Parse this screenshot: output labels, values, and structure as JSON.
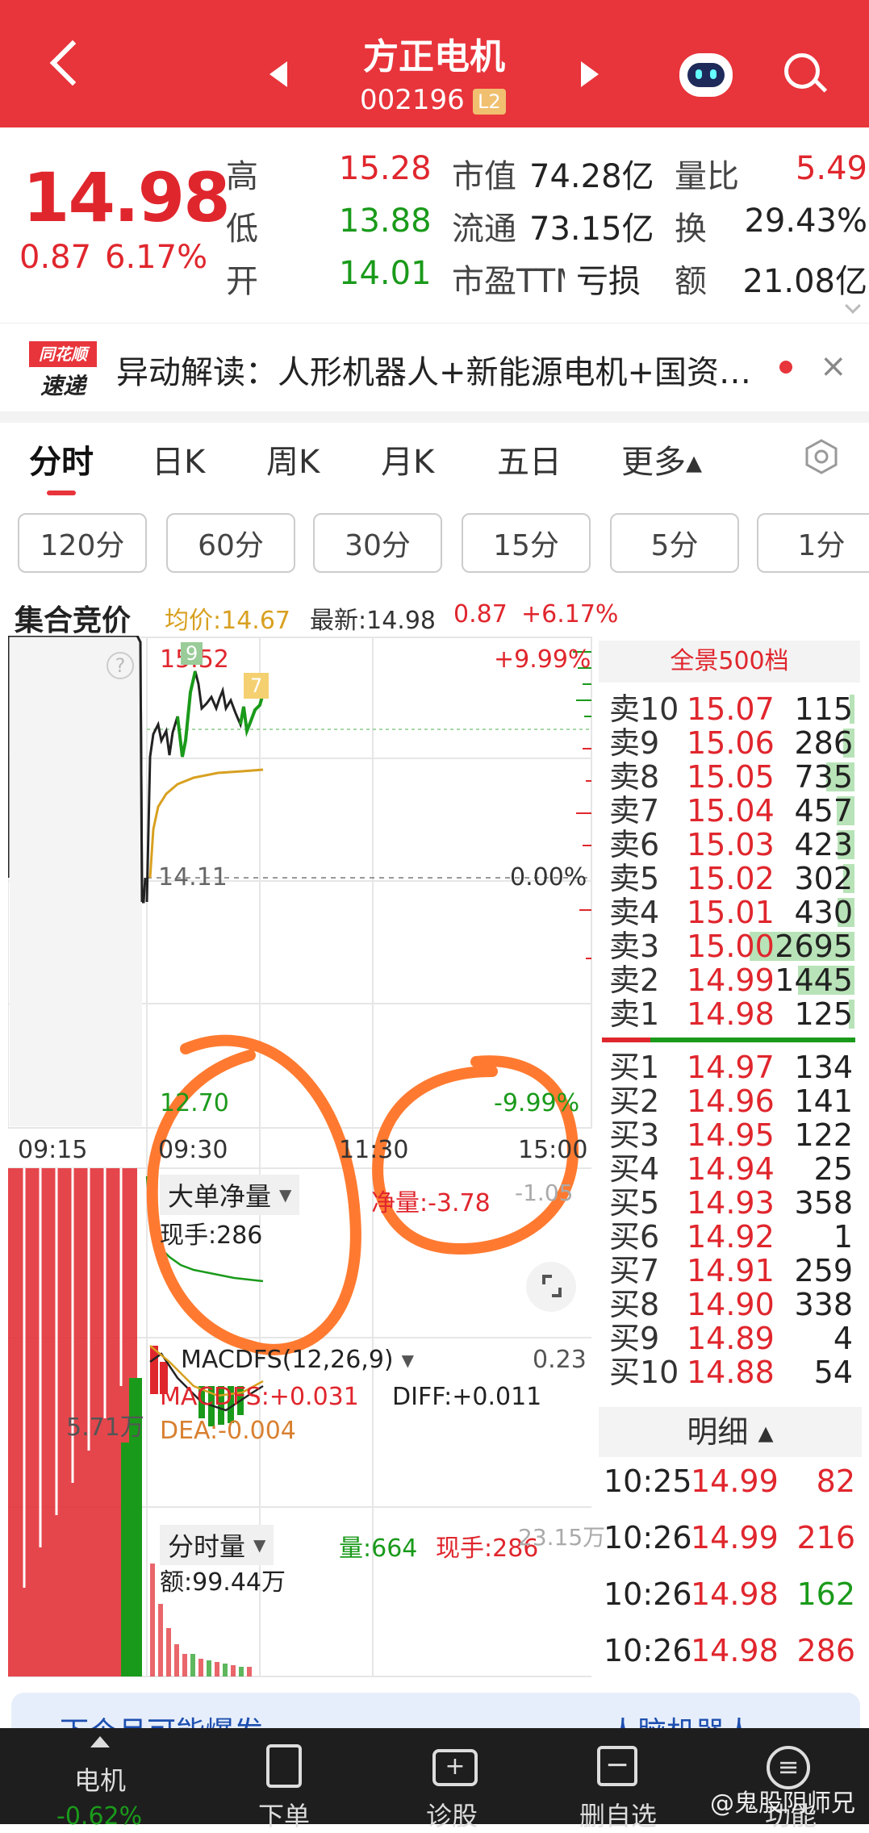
{
  "header": {
    "title": "方正电机",
    "code": "002196",
    "badge": "L2"
  },
  "quote": {
    "price": "14.98",
    "change": "0.87",
    "pct": "6.17%",
    "stats": [
      {
        "label": "高",
        "value": "15.28",
        "color": "red"
      },
      {
        "label": "低",
        "value": "13.88",
        "color": "green"
      },
      {
        "label": "开",
        "value": "14.01",
        "color": "green"
      }
    ],
    "mid": [
      {
        "label": "市值",
        "value": "74.28亿"
      },
      {
        "label": "流通",
        "value": "73.15亿"
      },
      {
        "label": "市盈TTM",
        "value": "亏损"
      }
    ],
    "right": [
      {
        "label": "量比",
        "value": "5.49"
      },
      {
        "label": "换",
        "value": "29.43%"
      },
      {
        "label": "额",
        "value": "21.08亿"
      }
    ]
  },
  "news": {
    "logo_top": "同花顺",
    "logo_bottom": "速递",
    "text": "异动解读：人形机器人+新能源电机+国资…"
  },
  "tabs": [
    "分时",
    "日K",
    "周K",
    "月K",
    "五日",
    "更多▴"
  ],
  "periods": [
    "120分",
    "60分",
    "30分",
    "15分",
    "5分",
    "1分"
  ],
  "chart_info": {
    "label": "集合竞价",
    "avg": "均价:14.67",
    "latest": "最新:14.98",
    "chg": "0.87",
    "pct": "+6.17%"
  },
  "chart": {
    "high_label": "15.52",
    "top_pct": "+9.99%",
    "mid_price": "14.11",
    "mid_pct": "0.00%",
    "low_price": "12.70",
    "low_pct": "-9.99%",
    "badge_left": "9",
    "badge_right": "7",
    "times": [
      "09:15",
      "09:30",
      "11:30",
      "15:00"
    ]
  },
  "big_order": {
    "title": "大单净量",
    "cur": "现手:286",
    "net": "净量:-3.78",
    "val": "-1.05"
  },
  "macd": {
    "title": "MACDFS(12,26,9)",
    "val": "0.23",
    "macd": "MACDFS:+0.031",
    "diff": "DIFF:+0.011",
    "dea": "DEA:-0.004",
    "left_val": "5.71万"
  },
  "volume": {
    "title": "分时量",
    "vol": "量:664",
    "cur": "现手:286",
    "max": "23.15万",
    "amt": "额:99.44万"
  },
  "orderbook": {
    "title": "全景500档",
    "asks": [
      {
        "l": "卖10",
        "p": "15.07",
        "v": "115",
        "w": 0.04
      },
      {
        "l": "卖9",
        "p": "15.06",
        "v": "286",
        "w": 0.11
      },
      {
        "l": "卖8",
        "p": "15.05",
        "v": "735",
        "w": 0.27
      },
      {
        "l": "卖7",
        "p": "15.04",
        "v": "457",
        "w": 0.17
      },
      {
        "l": "卖6",
        "p": "15.03",
        "v": "423",
        "w": 0.16
      },
      {
        "l": "卖5",
        "p": "15.02",
        "v": "302",
        "w": 0.11
      },
      {
        "l": "卖4",
        "p": "15.01",
        "v": "430",
        "w": 0.16
      },
      {
        "l": "卖3",
        "p": "15.00",
        "v": "2695",
        "w": 1.0
      },
      {
        "l": "卖2",
        "p": "14.99",
        "v": "1445",
        "w": 0.54
      },
      {
        "l": "卖1",
        "p": "14.98",
        "v": "125",
        "w": 0.05
      }
    ],
    "bids": [
      {
        "l": "买1",
        "p": "14.97",
        "v": "134"
      },
      {
        "l": "买2",
        "p": "14.96",
        "v": "141"
      },
      {
        "l": "买3",
        "p": "14.95",
        "v": "122"
      },
      {
        "l": "买4",
        "p": "14.94",
        "v": "25"
      },
      {
        "l": "买5",
        "p": "14.93",
        "v": "358"
      },
      {
        "l": "买6",
        "p": "14.92",
        "v": "1"
      },
      {
        "l": "买7",
        "p": "14.91",
        "v": "259"
      },
      {
        "l": "买8",
        "p": "14.90",
        "v": "338"
      },
      {
        "l": "买9",
        "p": "14.89",
        "v": "4"
      },
      {
        "l": "买10",
        "p": "14.88",
        "v": "54"
      }
    ]
  },
  "detail": {
    "title": "明细 ▴",
    "rows": [
      {
        "t": "10:25",
        "p": "14.99",
        "v": "82",
        "c": "red"
      },
      {
        "t": "10:26",
        "p": "14.99",
        "v": "216",
        "c": "red"
      },
      {
        "t": "10:26",
        "p": "14.98",
        "v": "162",
        "c": "green"
      },
      {
        "t": "10:26",
        "p": "14.98",
        "v": "286",
        "c": "red"
      }
    ]
  },
  "banner": {
    "left": "下个月可能爆发",
    "right": "人脑机器人"
  },
  "bottom_nav": [
    {
      "label": "电机",
      "sub": "-0.62%"
    },
    {
      "label": "下单"
    },
    {
      "label": "诊股"
    },
    {
      "label": "删自选"
    },
    {
      "label": "功能"
    }
  ],
  "watermark": "@鬼股阴师兄"
}
